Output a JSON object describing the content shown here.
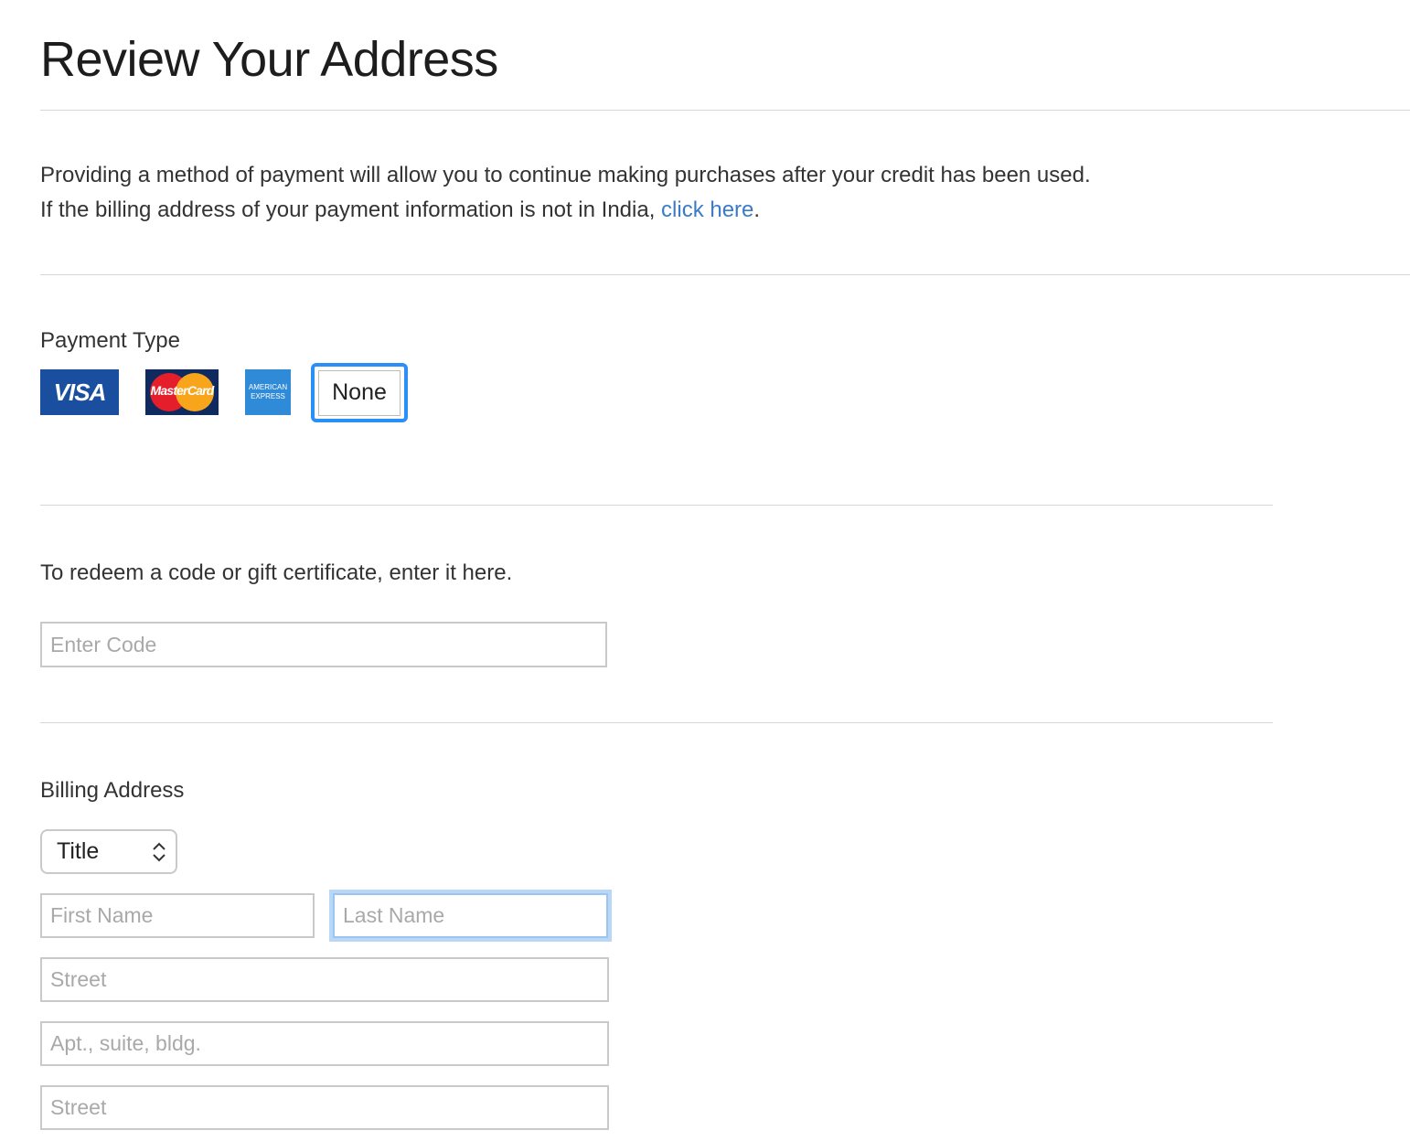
{
  "page": {
    "title": "Review Your Address"
  },
  "info": {
    "line1": "Providing a method of payment will allow you to continue making purchases after your credit has been used.",
    "line2_prefix": "If the billing address of your payment information is not in India, ",
    "line2_link": "click here",
    "line2_suffix": "."
  },
  "payment": {
    "label": "Payment Type",
    "cards": [
      {
        "name": "Visa",
        "text": "VISA",
        "icon": "visa-card-icon"
      },
      {
        "name": "MasterCard",
        "text": "MasterCard",
        "icon": "mastercard-card-icon"
      },
      {
        "name": "American Express",
        "text_line1": "AMERICAN",
        "text_line2": "EXPRESS",
        "icon": "amex-card-icon"
      }
    ],
    "none_label": "None",
    "selected": "None",
    "accent_color": "#2a8ff7"
  },
  "redeem": {
    "label": "To redeem a code or gift certificate, enter it here.",
    "placeholder": "Enter Code"
  },
  "billing": {
    "label": "Billing Address",
    "title_select": "Title",
    "first_name_placeholder": "First Name",
    "last_name_placeholder": "Last Name",
    "street_placeholder": "Street",
    "apt_placeholder": "Apt., suite, bldg.",
    "street2_placeholder": "Street",
    "focused_field": "Last Name"
  },
  "colors": {
    "link": "#3a7bc8",
    "focus_ring": "#b9d7f7"
  }
}
